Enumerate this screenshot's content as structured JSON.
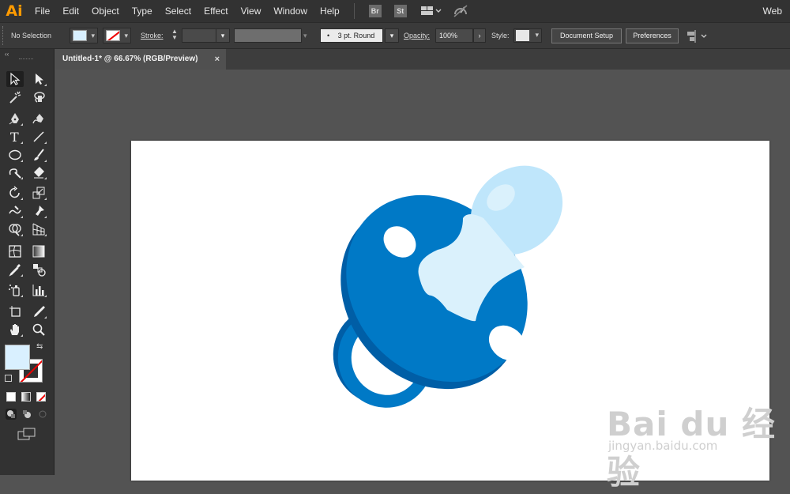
{
  "app": {
    "logo": "Ai",
    "workspace": "Web"
  },
  "menu": [
    "File",
    "Edit",
    "Object",
    "Type",
    "Select",
    "Effect",
    "View",
    "Window",
    "Help"
  ],
  "bridge_buttons": [
    "Br",
    "St"
  ],
  "control": {
    "selection": "No Selection",
    "stroke_label": "Stroke:",
    "brush": "3 pt. Round",
    "opacity_label": "Opacity:",
    "opacity_value": "100%",
    "style_label": "Style:",
    "document_setup": "Document Setup",
    "preferences": "Preferences"
  },
  "document": {
    "tab_title": "Untitled-1* @ 66.67% (RGB/Preview)",
    "close": "×"
  },
  "colors": {
    "fill": "#d9f0ff",
    "pacifier_blue": "#0079c6",
    "pacifier_dark": "#005ea6",
    "nipple": "#bfe6fb",
    "nipple_light": "#daf1fc"
  },
  "tools": [
    "selection-tool",
    "direct-selection-tool",
    "magic-wand-tool",
    "lasso-tool",
    "pen-tool",
    "curvature-tool",
    "type-tool",
    "line-tool",
    "ellipse-tool",
    "paintbrush-tool",
    "shaper-tool",
    "eraser-tool",
    "rotate-tool",
    "scale-tool",
    "warp-tool",
    "puppet-warp-tool",
    "shape-builder-tool",
    "perspective-grid-tool",
    "mesh-tool",
    "gradient-tool",
    "eyedropper-tool",
    "blend-tool",
    "symbol-sprayer-tool",
    "column-graph-tool",
    "artboard-tool",
    "slice-tool",
    "hand-tool",
    "zoom-tool"
  ],
  "watermark": {
    "logo": "Bai du 经验",
    "sub": "jingyan.baidu.com"
  }
}
